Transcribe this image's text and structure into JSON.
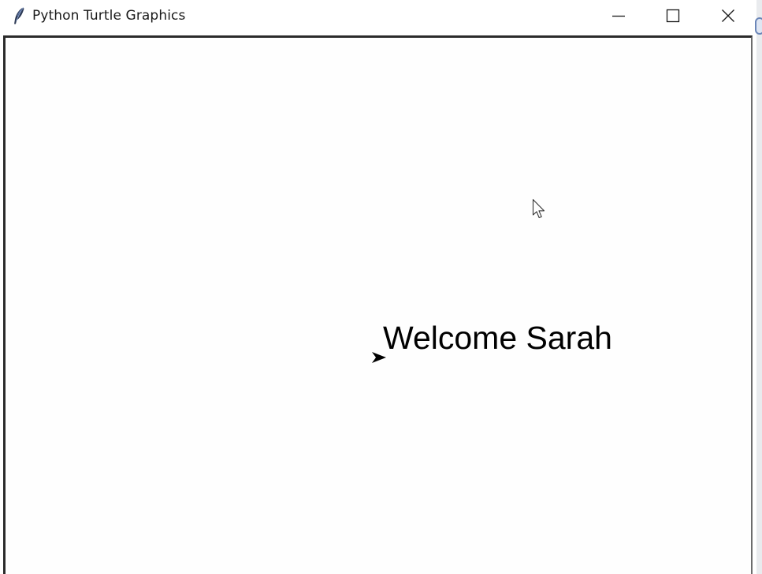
{
  "window": {
    "title": "Python Turtle Graphics",
    "app_icon": "feather-icon",
    "controls": {
      "minimize": "minimize-icon",
      "maximize": "maximize-icon",
      "close": "close-icon"
    }
  },
  "canvas": {
    "text": "Welcome Sarah",
    "turtle_icon": "turtle-arrow-icon",
    "pointer_icon": "mouse-pointer-icon",
    "background": "#ffffff",
    "text_color": "#000000"
  }
}
